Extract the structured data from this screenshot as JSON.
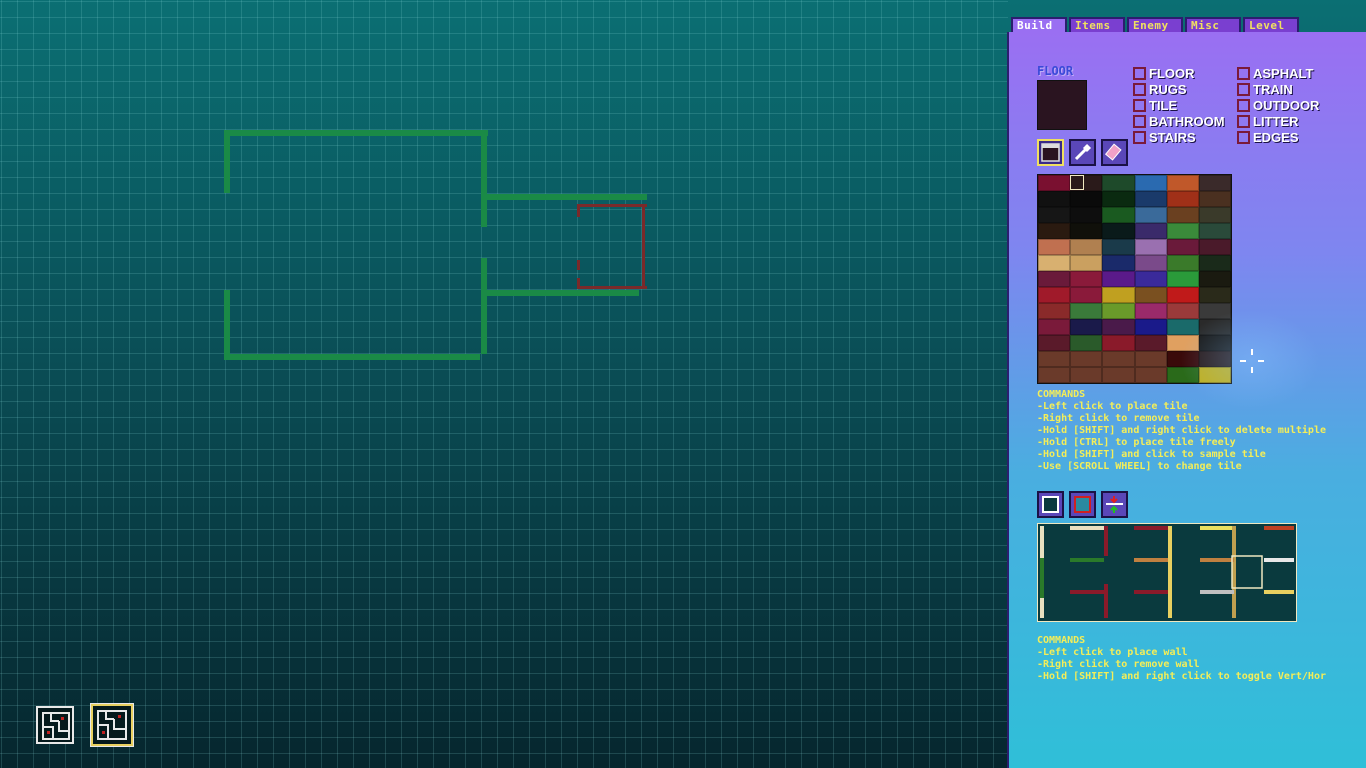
{
  "tabs": [
    "Build",
    "Items",
    "Enemy",
    "Misc",
    "Level"
  ],
  "active_tab": "Build",
  "floor": {
    "title": "FLOOR",
    "categories_left": [
      "FLOOR",
      "RUGS",
      "TILE",
      "BATHROOM",
      "STAIRS"
    ],
    "categories_right": [
      "ASPHALT",
      "TRAIN",
      "OUTDOOR",
      "LITTER",
      "EDGES"
    ]
  },
  "tools": {
    "icons": [
      "tile-brush-icon",
      "eyedropper-icon",
      "eraser-icon"
    ]
  },
  "tile_commands": {
    "title": "COMMANDS",
    "lines": [
      "-Left click to place tile",
      "-Right click to remove tile",
      "-Hold [SHIFT] and right click to delete multiple",
      "-Hold [CTRL] to place tile freely",
      "-Hold [SHIFT] and click to sample tile",
      "-Use [SCROLL WHEEL] to change tile"
    ]
  },
  "wall_tools": {
    "icons": [
      "wall-outline-icon",
      "wall-solid-icon",
      "wall-toggle-icon"
    ]
  },
  "wall_commands": {
    "title": "COMMANDS",
    "lines": [
      "-Left click to place wall",
      "-Right click to remove wall",
      "-Hold [SHIFT] and right click to toggle Vert/Hor"
    ]
  },
  "colors": {
    "wall_green": "#1a8a46",
    "wall_red": "#7a2a2a",
    "command_text": "#f4ee58",
    "panel_top": "#9a6ff2",
    "panel_bottom": "#2fbfd8"
  },
  "palette_colors": [
    "#7a1030",
    "#2a1a1a",
    "#1e4a2a",
    "#2a6ab0",
    "#c0582a",
    "#3a2a2a",
    "#111111",
    "#0a0a0a",
    "#0a2a10",
    "#1a3a6a",
    "#a03018",
    "#4a3020",
    "#161616",
    "#0e0e0e",
    "#1a5a20",
    "#3a6a9a",
    "#6a4020",
    "#3a3a2a",
    "#2a1a10",
    "#10100a",
    "#0a1a1a",
    "#3a2a6a",
    "#3a8a3a",
    "#2a4a3a",
    "#c07050",
    "#b08050",
    "#1a3a4a",
    "#9a70b0",
    "#6a1a3a",
    "#4a1a2a",
    "#d8b070",
    "#caa060",
    "#1a2a6a",
    "#7a4a8a",
    "#3a7a2a",
    "#1a2a1a",
    "#6a1a3a",
    "#8a1a3a",
    "#5a1a8a",
    "#3a2a9a",
    "#2a9a3a",
    "#1a1a10",
    "#a01a2a",
    "#8a1a3a",
    "#c0a020",
    "#7a5020",
    "#c01a1a",
    "#2a2a1a",
    "#8a2a2a",
    "#3a7a3a",
    "#6a9a2a",
    "#9a2a6a",
    "#9a3a3a",
    "#3a3a3a",
    "#7a1a3a",
    "#1a1a4a",
    "#4a1a4a",
    "#1a1a8a",
    "#1a6a6a",
    "#2a2a2a",
    "#5a1a2a",
    "#2a5a2a",
    "#8a1a2a",
    "#5a1a2a",
    "#e0a060",
    "#1a1a1a",
    "#6a3a2a",
    "#6a3a2a",
    "#6a3a2a",
    "#6a3a2a",
    "#3a0a0a",
    "#2a1a1a",
    "#6a3a2a",
    "#6a3a2a",
    "#6a3a2a",
    "#6a3a2a",
    "#2a6a1a",
    "#c0b020"
  ]
}
